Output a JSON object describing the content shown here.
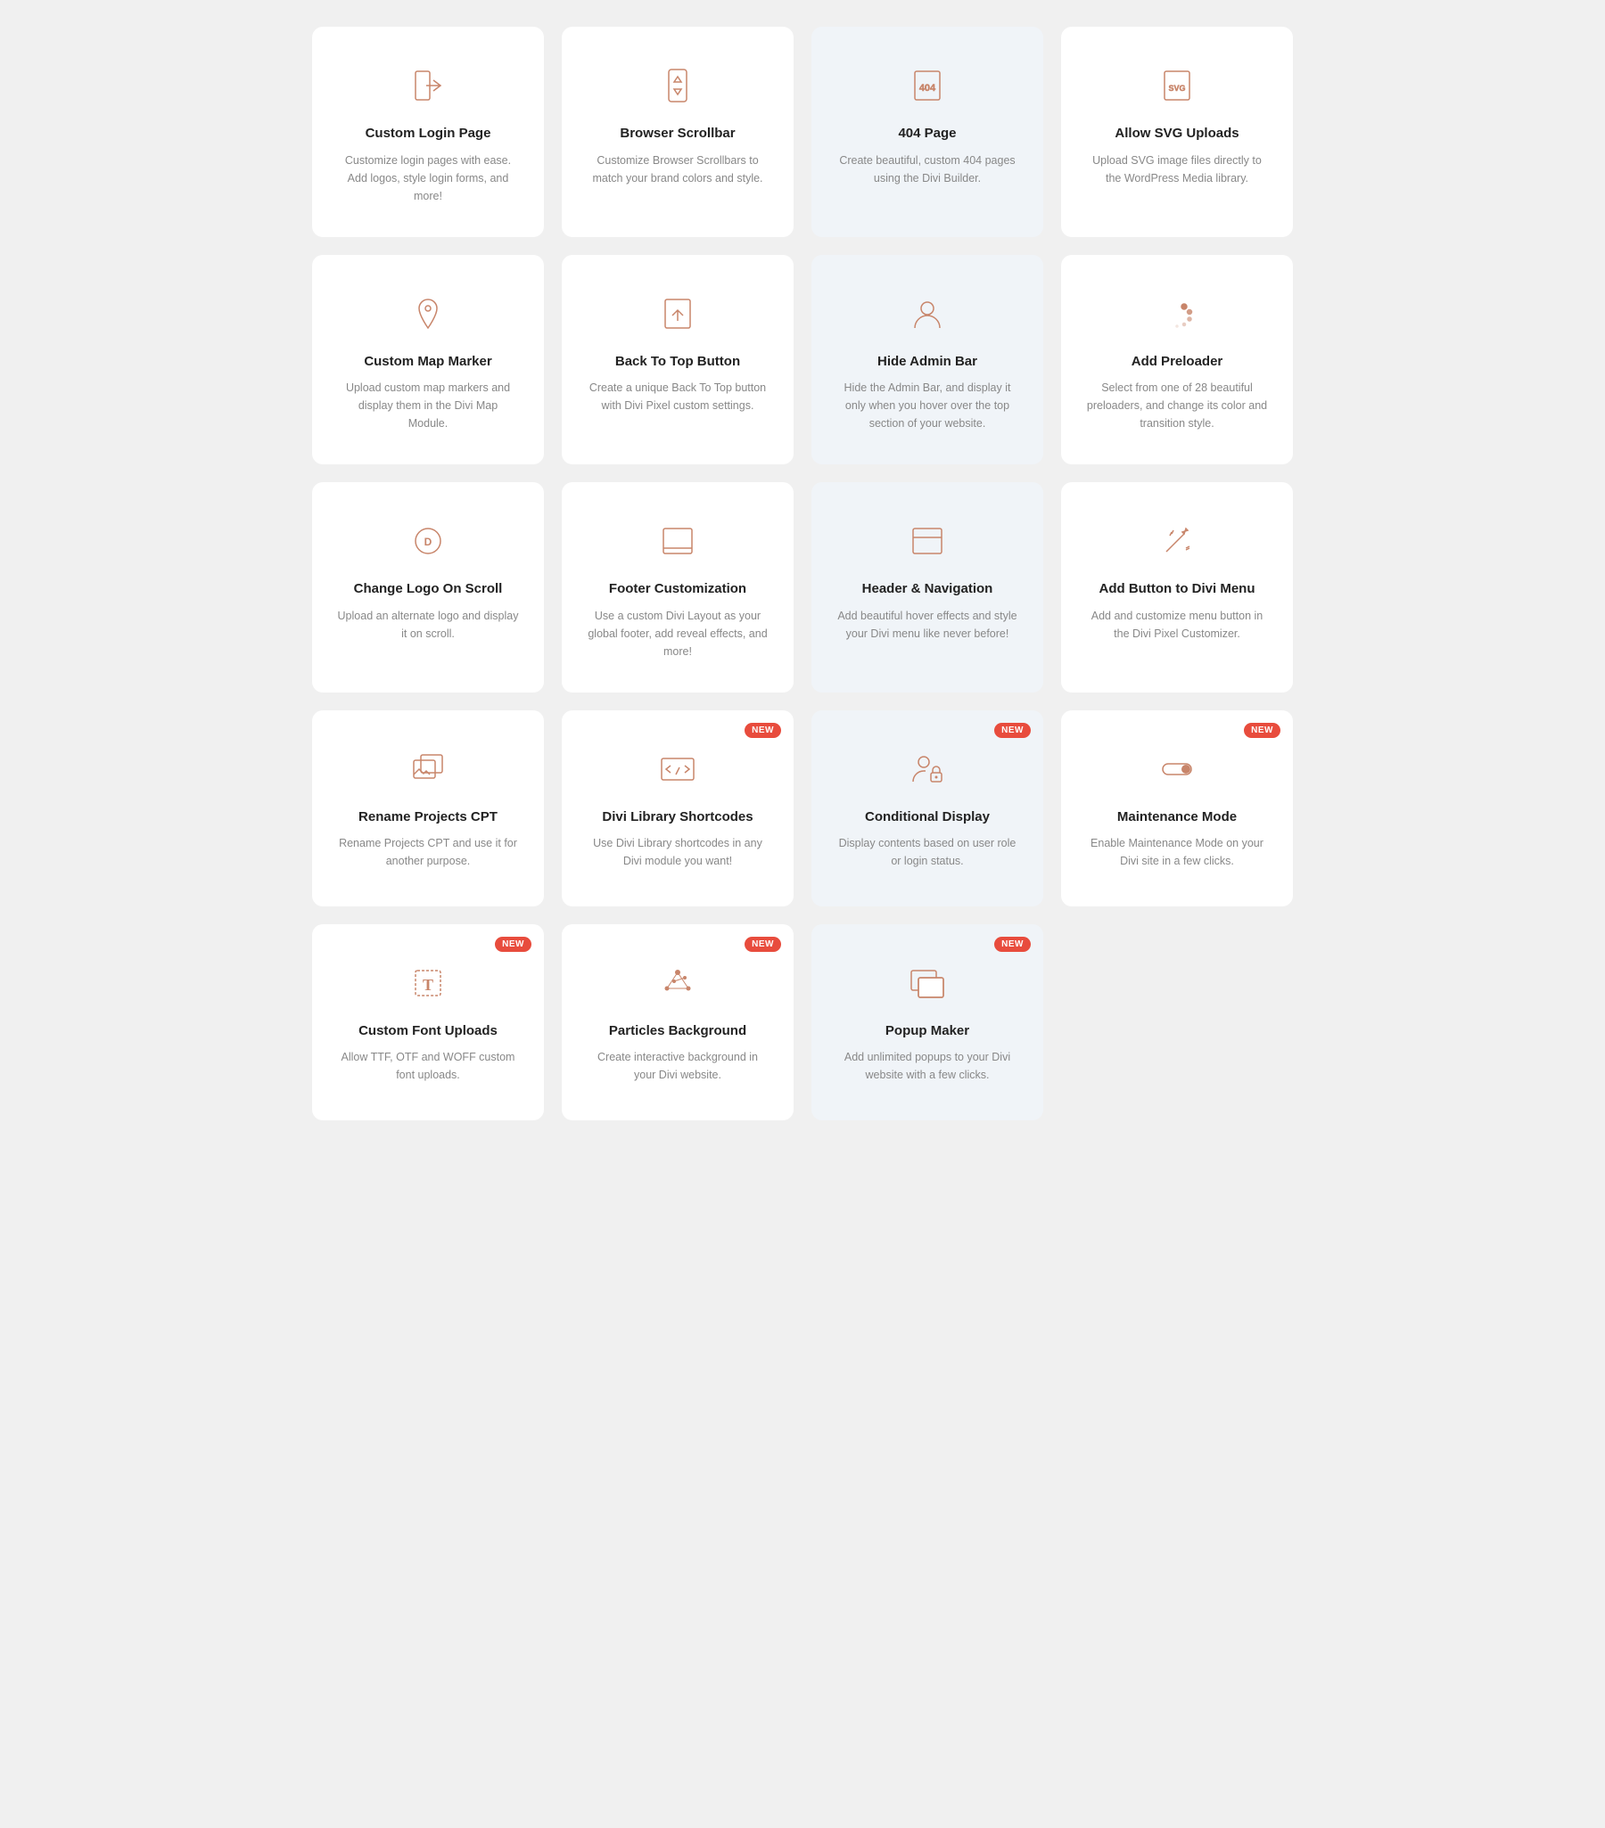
{
  "cards": [
    {
      "id": "custom-login-page",
      "title": "Custom Login Page",
      "desc": "Customize login pages with ease. Add logos, style login forms, and more!",
      "icon": "login",
      "badge": null,
      "highlight": false
    },
    {
      "id": "browser-scrollbar",
      "title": "Browser Scrollbar",
      "desc": "Customize Browser Scrollbars to match your brand colors and style.",
      "icon": "scrollbar",
      "badge": null,
      "highlight": false
    },
    {
      "id": "404-page",
      "title": "404 Page",
      "desc": "Create beautiful, custom 404 pages using the Divi Builder.",
      "icon": "404",
      "badge": null,
      "highlight": true
    },
    {
      "id": "allow-svg-uploads",
      "title": "Allow SVG Uploads",
      "desc": "Upload SVG image files directly to the WordPress Media library.",
      "icon": "svg",
      "badge": null,
      "highlight": false
    },
    {
      "id": "custom-map-marker",
      "title": "Custom Map Marker",
      "desc": "Upload custom map markers and display them in the Divi Map Module.",
      "icon": "map-marker",
      "badge": null,
      "highlight": false
    },
    {
      "id": "back-to-top-button",
      "title": "Back To Top Button",
      "desc": "Create a unique Back To Top button with Divi Pixel custom settings.",
      "icon": "arrow-up",
      "badge": null,
      "highlight": false
    },
    {
      "id": "hide-admin-bar",
      "title": "Hide Admin Bar",
      "desc": "Hide the Admin Bar, and display it only when you hover over the top section of your website.",
      "icon": "user",
      "badge": null,
      "highlight": true
    },
    {
      "id": "add-preloader",
      "title": "Add Preloader",
      "desc": "Select from one of 28 beautiful preloaders, and change its color and transition style.",
      "icon": "preloader",
      "badge": null,
      "highlight": false
    },
    {
      "id": "change-logo-on-scroll",
      "title": "Change Logo On Scroll",
      "desc": "Upload an alternate logo and display it on scroll.",
      "icon": "logo-scroll",
      "badge": null,
      "highlight": false
    },
    {
      "id": "footer-customization",
      "title": "Footer Customization",
      "desc": "Use a custom Divi Layout as your global footer, add reveal effects, and more!",
      "icon": "footer",
      "badge": null,
      "highlight": false
    },
    {
      "id": "header-navigation",
      "title": "Header & Navigation",
      "desc": "Add beautiful hover effects and style your Divi menu like never before!",
      "icon": "header-nav",
      "badge": null,
      "highlight": true
    },
    {
      "id": "add-button-divi-menu",
      "title": "Add Button to Divi Menu",
      "desc": "Add and customize menu button in the Divi Pixel Customizer.",
      "icon": "wand",
      "badge": null,
      "highlight": false
    },
    {
      "id": "rename-projects-cpt",
      "title": "Rename Projects CPT",
      "desc": "Rename Projects CPT and use it for another purpose.",
      "icon": "image-gallery",
      "badge": null,
      "highlight": false
    },
    {
      "id": "divi-library-shortcodes",
      "title": "Divi Library Shortcodes",
      "desc": "Use Divi Library shortcodes in any Divi module you want!",
      "icon": "code",
      "badge": "NEW",
      "highlight": false
    },
    {
      "id": "conditional-display",
      "title": "Conditional Display",
      "desc": "Display contents based on user role or login status.",
      "icon": "user-lock",
      "badge": "NEW",
      "highlight": true
    },
    {
      "id": "maintenance-mode",
      "title": "Maintenance Mode",
      "desc": "Enable Maintenance Mode on your Divi site in a few clicks.",
      "icon": "toggle",
      "badge": "NEW",
      "highlight": false
    },
    {
      "id": "custom-font-uploads",
      "title": "Custom Font Uploads",
      "desc": "Allow TTF, OTF and WOFF custom font uploads.",
      "icon": "font",
      "badge": "NEW",
      "highlight": false
    },
    {
      "id": "particles-background",
      "title": "Particles Background",
      "desc": "Create interactive background in your Divi website.",
      "icon": "particles",
      "badge": "NEW",
      "highlight": false
    },
    {
      "id": "popup-maker",
      "title": "Popup Maker",
      "desc": "Add unlimited popups to your Divi website with a few clicks.",
      "icon": "popup",
      "badge": "NEW",
      "highlight": true
    }
  ]
}
